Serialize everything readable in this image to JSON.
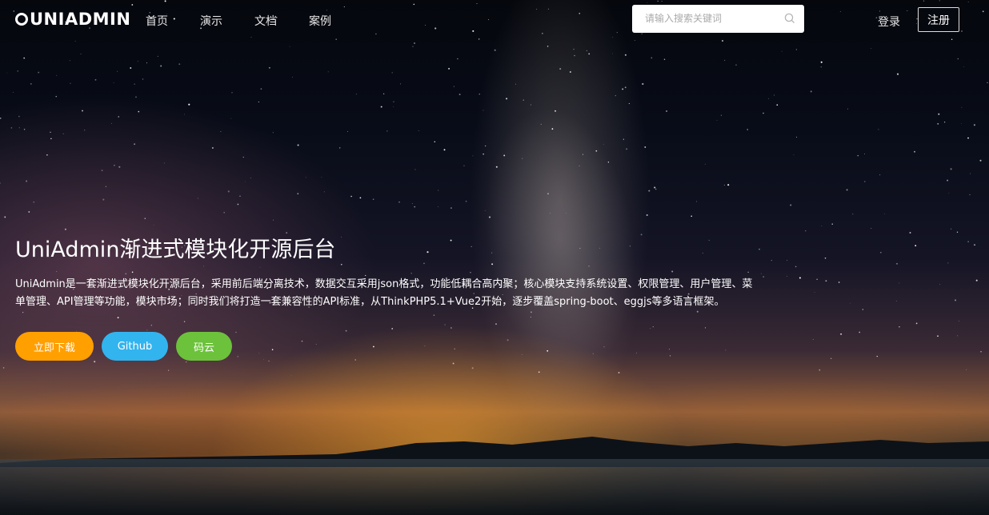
{
  "nav": {
    "logo_text": "UNIADMIN",
    "links": [
      "首页",
      "演示",
      "文档",
      "案例"
    ],
    "search_placeholder": "请输入搜索关键词",
    "login": "登录",
    "register": "注册"
  },
  "hero": {
    "title": "UniAdmin渐进式模块化开源后台",
    "description": "UniAdmin是一套渐进式模块化开源后台，采用前后端分离技术，数据交互采用json格式，功能低耦合高内聚；核心模块支持系统设置、权限管理、用户管理、菜单管理、API管理等功能，模块市场；同时我们将打造一套兼容性的API标准，从ThinkPHP5.1+Vue2开始，逐步覆盖spring-boot、eggjs等多语言框架。",
    "buttons": {
      "download": "立即下载",
      "github": "Github",
      "gitee": "码云"
    }
  },
  "colors": {
    "download": "#ff9f00",
    "github": "#32b4ef",
    "gitee": "#6cc23b",
    "logo_accent": "#f5a623"
  },
  "icons": {
    "search": "search-icon"
  }
}
